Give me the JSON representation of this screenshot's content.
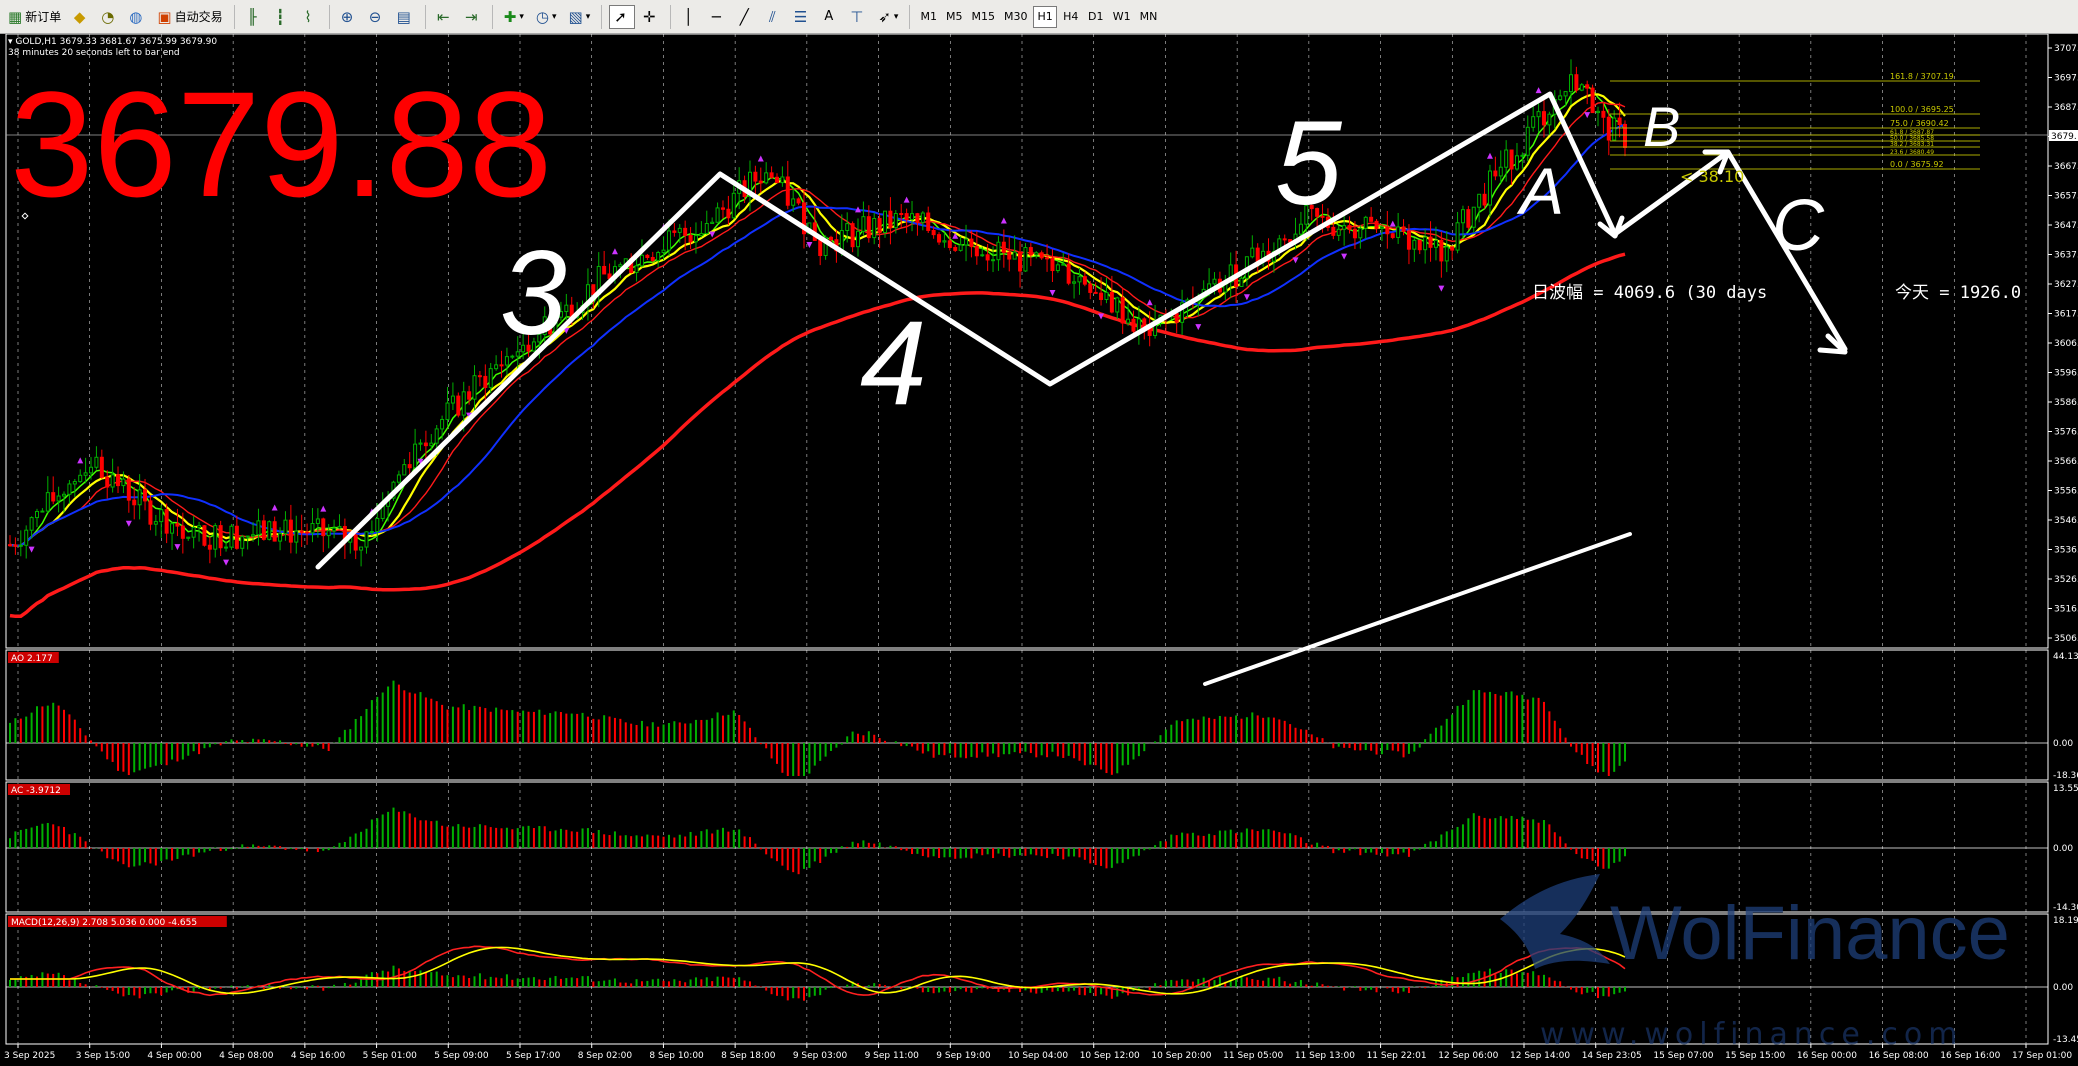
{
  "toolbar": {
    "new_order_label": "新订单",
    "auto_trade_label": "自动交易",
    "timeframes": [
      "M1",
      "M5",
      "M15",
      "M30",
      "H1",
      "H4",
      "D1",
      "W1",
      "MN"
    ],
    "active_timeframe": "H1",
    "tools": [
      "cursor-icon",
      "crosshair-icon",
      "vertical-line-icon",
      "horizontal-line-icon",
      "trendline-icon",
      "fibonacci-icon",
      "text-tool-icon",
      "label-tool-icon",
      "arrow-tool-icon"
    ]
  },
  "chart": {
    "symbol_line": "GOLD,H1  3679.33 3681.67 3675.99 3679.90",
    "countdown": "38 minutes 20 seconds left to bar end",
    "big_price": "3679.88",
    "current_price_label": "3679.",
    "daily_range_text": "日波幅 = 4069.6  (30 days",
    "today_text": "今天 = 1926.0",
    "distance_text": "< 38.10",
    "price_axis": [
      "3707.",
      "3697.",
      "3687.",
      "3677.",
      "3667.",
      "3657.",
      "3647.",
      "3637.",
      "3627.",
      "3617.",
      "3606.",
      "3596.",
      "3586.",
      "3576.",
      "3566.",
      "3556.",
      "3546.",
      "3536.",
      "3526.",
      "3516.",
      "3506."
    ],
    "fib_levels": [
      {
        "label": "161.8 / 3707.19"
      },
      {
        "label": "100.0 / 3695.25"
      },
      {
        "label": "75.0 / 3690.42"
      },
      {
        "label": "61.8 / 3687.87"
      },
      {
        "label": "50.0 / 3685.58"
      },
      {
        "label": "38.2 / 3683.31"
      },
      {
        "label": "23.6 / 3680.49"
      },
      {
        "label": "0.0 / 3675.92"
      }
    ],
    "wave_labels": [
      "3",
      "4",
      "5",
      "A",
      "B",
      "C"
    ],
    "time_axis": [
      "3 Sep 2025",
      "3 Sep 15:00",
      "4 Sep 00:00",
      "4 Sep 08:00",
      "4 Sep 16:00",
      "5 Sep 01:00",
      "5 Sep 09:00",
      "5 Sep 17:00",
      "8 Sep 02:00",
      "8 Sep 10:00",
      "8 Sep 18:00",
      "9 Sep 03:00",
      "9 Sep 11:00",
      "9 Sep 19:00",
      "10 Sep 04:00",
      "10 Sep 12:00",
      "10 Sep 20:00",
      "11 Sep 05:00",
      "11 Sep 13:00",
      "11 Sep 22:01",
      "12 Sep 06:00",
      "12 Sep 14:00",
      "14 Sep 23:05",
      "15 Sep 07:00",
      "15 Sep 15:00",
      "16 Sep 00:00",
      "16 Sep 08:00",
      "16 Sep 16:00",
      "17 Sep 01:00"
    ]
  },
  "indicators": {
    "ao": {
      "label": "AO 2.177",
      "axis_top": "44.135",
      "axis_zero": "0.00",
      "axis_bottom": "-18.36"
    },
    "ac": {
      "label": "AC -3.9712",
      "axis_top": "13.55",
      "axis_zero": "0.00",
      "axis_bottom": "-14.30"
    },
    "macd": {
      "label": "MACD(12,26,9) 2.708 5.036 0.000 -4.655",
      "axis_top": "18.19",
      "axis_zero": "0.00",
      "axis_bottom": "-13.45"
    }
  },
  "watermark": {
    "brand": "WolFinance",
    "url": "www.wolfinance.com"
  },
  "colors": {
    "bull": "#00b000",
    "bear": "#ff0000",
    "ma_red": "#ff1a1a",
    "ma_yellow": "#ffff00",
    "ma_green": "#44ff00",
    "ma_blue": "#1030ff",
    "fib": "#c8c800",
    "grid": "#ffffff",
    "price_big": "#ff0000"
  }
}
